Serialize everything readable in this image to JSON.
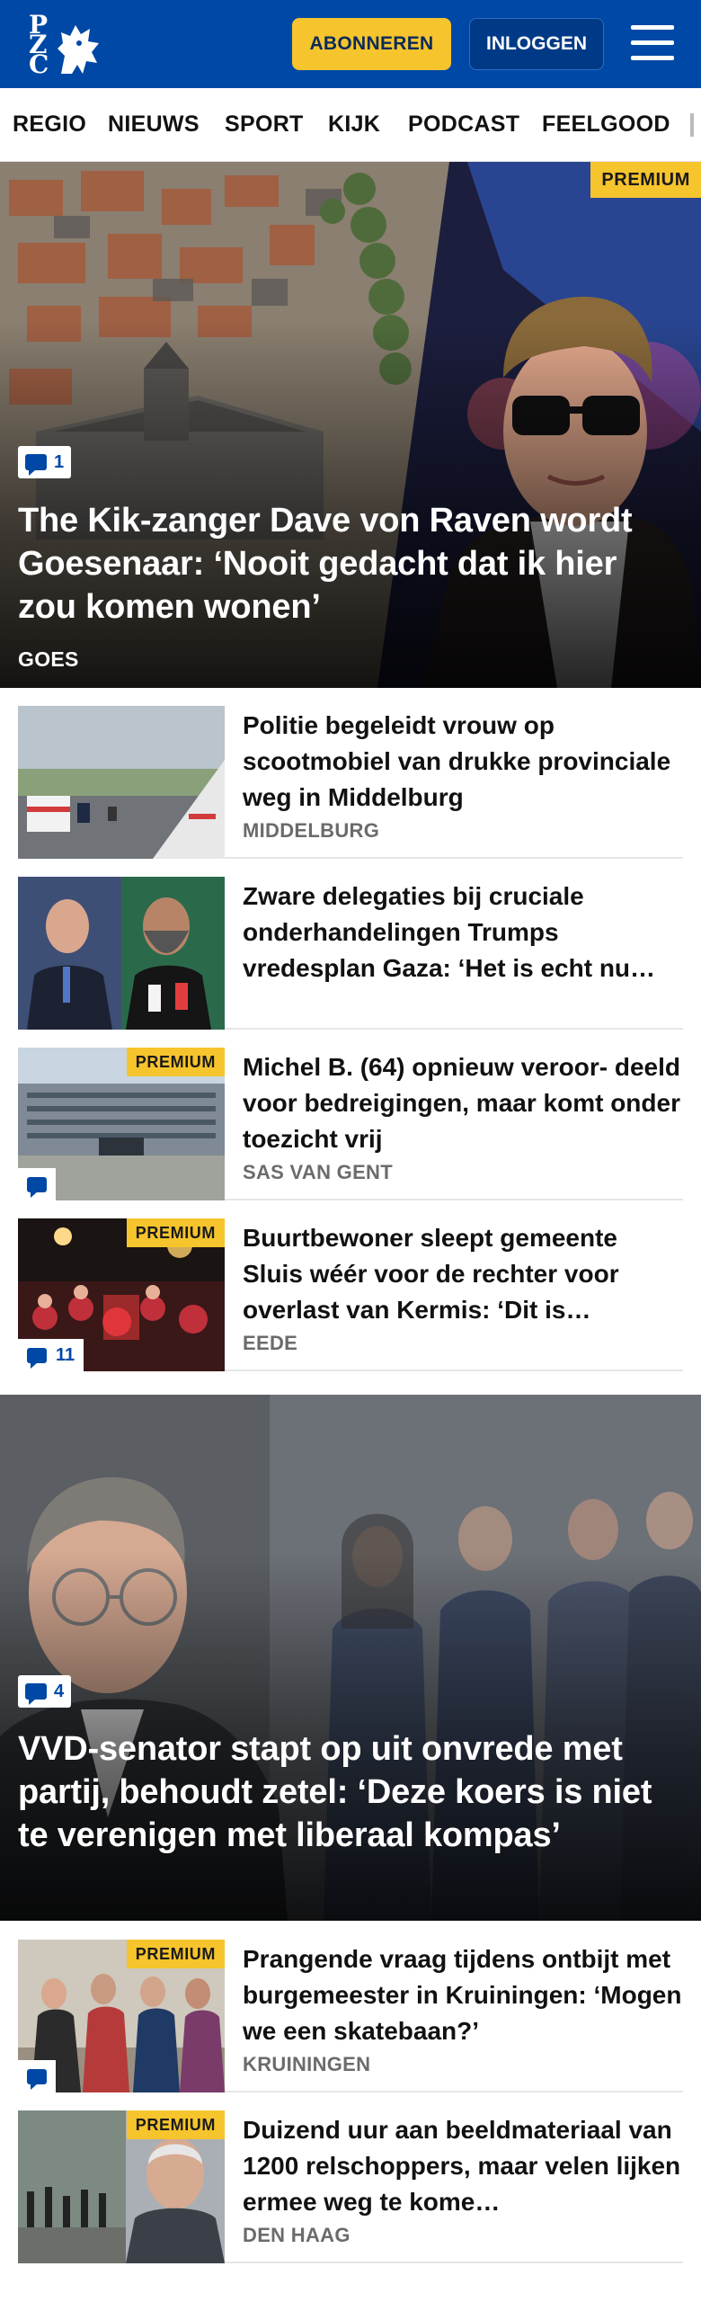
{
  "header": {
    "logo_letters": [
      "P",
      "Z",
      "C"
    ],
    "subscribe_label": "ABONNEREN",
    "login_label": "INLOGGEN",
    "colors": {
      "brand_blue": "#0048a6",
      "accent_yellow": "#f6c42c"
    }
  },
  "nav": {
    "items": [
      {
        "label": "REGIO"
      },
      {
        "label": "NIEUWS"
      },
      {
        "label": "SPORT"
      },
      {
        "label": "KIJK"
      },
      {
        "label": "PODCAST"
      },
      {
        "label": "FEELGOOD"
      }
    ]
  },
  "hero1": {
    "premium": "PREMIUM",
    "comments": "1",
    "title": "The Kik-zanger Dave von Raven wordt Goesenaar: ‘Nooit gedacht dat ik hier zou komen wonen’",
    "category": "GOES"
  },
  "list1": [
    {
      "title": "Politie begeleidt vrouw op scootmobiel van drukke provinciale weg in Middelburg",
      "category": "MIDDELBURG"
    },
    {
      "title": "Zware delegaties bij cruciale onderhandelingen Trumps vredesplan Gaza: ‘Het is echt nu…",
      "category": ""
    },
    {
      "premium": "PREMIUM",
      "title": "Michel B. (64) opnieuw veroor- deeld voor bedreigingen, maar komt onder toezicht vrij",
      "category": "SAS VAN GENT"
    },
    {
      "premium": "PREMIUM",
      "comments": "11",
      "title": "Buurtbewoner sleept gemeente Sluis wéér voor de rechter voor overlast van Kermis: ‘Dit is…",
      "category": "EEDE"
    }
  ],
  "hero2": {
    "comments": "4",
    "title": "VVD-senator stapt op uit onvrede met partij, behoudt zetel: ‘Deze koers is niet te verenigen met liberaal kompas’"
  },
  "list2": [
    {
      "premium": "PREMIUM",
      "title": "Prangende vraag tijdens ontbijt met burgemeester in Kruiningen: ‘Mogen we een skatebaan?’",
      "category": "KRUININGEN"
    },
    {
      "premium": "PREMIUM",
      "title": "Duizend uur aan beeldmateriaal van 1200 relschoppers, maar velen lijken ermee weg te kome…",
      "category": "DEN HAAG"
    }
  ]
}
